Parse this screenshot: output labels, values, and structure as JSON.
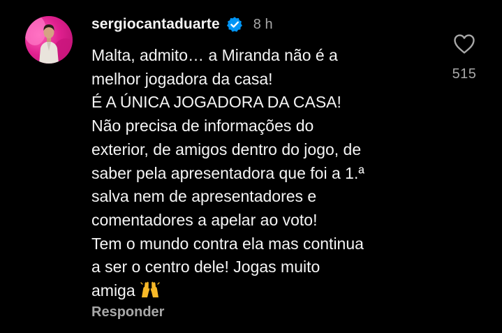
{
  "comment": {
    "username": "sergiocantaduarte",
    "verified_icon": "verified-badge-icon",
    "timestamp": "8 h",
    "lines": [
      "Malta, admito… a Miranda não é a",
      "melhor jogadora da casa!",
      "É A ÚNICA JOGADORA DA CASA!",
      "Não precisa de informações do",
      "exterior, de amigos dentro do jogo, de",
      "saber pela apresentadora que foi a 1.ª",
      "salva nem de apresentadores e",
      "comentadores a apelar ao voto!",
      "Tem o mundo contra ela mas continua",
      "a ser o centro dele! Jogas muito",
      "amiga"
    ],
    "emoji": "raising-hands-emoji",
    "reply_label": "Responder",
    "like_icon": "heart-outline-icon",
    "like_count": "515"
  },
  "colors": {
    "background": "#000000",
    "primary_text": "#f5f5f5",
    "secondary_text": "#a8a8a8",
    "verified_blue": "#0095f6"
  }
}
